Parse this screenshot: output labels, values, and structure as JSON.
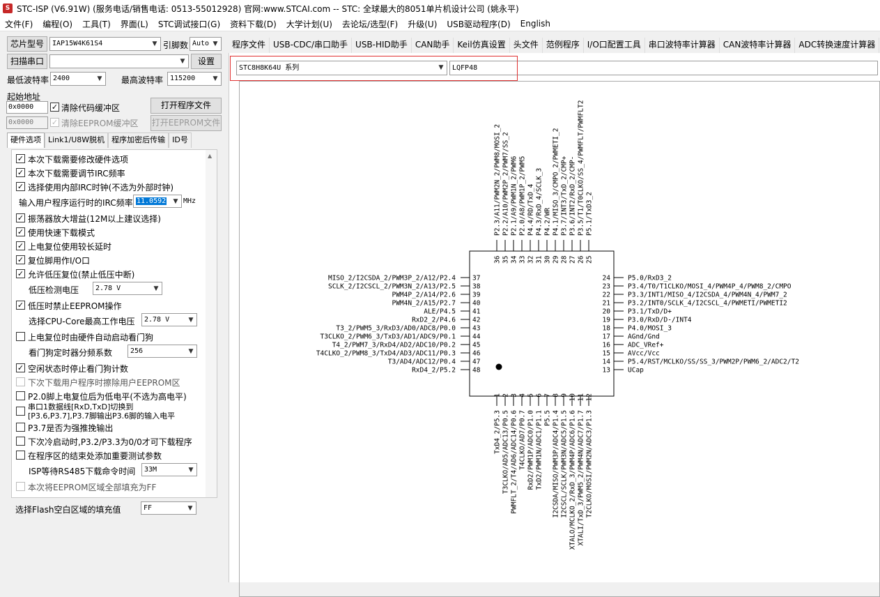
{
  "title": "STC-ISP (V6.91W) (服务电话/销售电话: 0513-55012928) 官网:www.STCAI.com  -- STC: 全球最大的8051单片机设计公司 (姚永平)",
  "menu": [
    "文件(F)",
    "编程(O)",
    "工具(T)",
    "界面(L)",
    "STC调试接口(G)",
    "资料下载(D)",
    "大学计划(U)",
    "去论坛/选型(F)",
    "升级(U)",
    "USB驱动程序(D)",
    "English"
  ],
  "left": {
    "chip_btn": "芯片型号",
    "chip_val": "IAP15W4K61S4",
    "pin_lbl": "引脚数",
    "pin_val": "Auto",
    "scan_btn": "扫描串口",
    "scan_val": "",
    "settings_btn": "设置",
    "minbaud_lbl": "最低波特率",
    "minbaud_val": "2400",
    "maxbaud_lbl": "最高波特率",
    "maxbaud_val": "115200",
    "start_lbl": "起始地址",
    "addr1": "0x0000",
    "clear_code": "清除代码缓冲区",
    "open_prog": "打开程序文件",
    "addr2": "0x0000",
    "clear_eeprom": "清除EEPROM缓冲区",
    "open_eeprom": "打开EEPROM文件",
    "tabs": [
      "硬件选项",
      "Link1/U8W脱机",
      "程序加密后传输",
      "ID号"
    ],
    "hw": {
      "o1": "本次下载需要修改硬件选项",
      "o2": "本次下载需要调节IRC频率",
      "o3": "选择使用内部IRC时钟(不选为外部时钟)",
      "irc_lbl": "输入用户程序运行时的IRC频率",
      "irc_val": "11.0592",
      "irc_unit": "MHz",
      "o4": "振荡器放大增益(12M以上建议选择)",
      "o5": "使用快速下载模式",
      "o6": "上电复位使用较长延时",
      "o7": "复位脚用作I/O口",
      "o8": "允许低压复位(禁止低压中断)",
      "lv_lbl": "低压检测电压",
      "lv_val": "2.78 V",
      "o9": "低压时禁止EEPROM操作",
      "cpu_lbl": "选择CPU-Core最高工作电压",
      "cpu_val": "2.78 V",
      "o10": "上电复位时由硬件自动启动看门狗",
      "wd_lbl": "看门狗定时器分频系数",
      "wd_val": "256",
      "o11": "空闲状态时停止看门狗计数",
      "o12": "下次下载用户程序时擦除用户EEPROM区",
      "o13": "P2.0脚上电复位后为低电平(不选为高电平)",
      "o14a": "串口1数据线[RxD,TxD]切换到",
      "o14b": "[P3.6,P3.7],P3.7脚输出P3.6脚的输入电平",
      "o15": "P3.7是否为强推挽输出",
      "o16": "下次冷启动时,P3.2/P3.3为0/0才可下载程序",
      "o17": "在程序区的结束处添加重要测试参数",
      "rs_lbl": "ISP等待RS485下载命令时间",
      "rs_val": "33M",
      "o18": "本次将EEPROM区域全部填充为FF"
    },
    "fill_lbl": "选择Flash空白区域的填充值",
    "fill_val": "FF"
  },
  "rtabs": [
    "程序文件",
    "USB-CDC/串口助手",
    "USB-HID助手",
    "CAN助手",
    "Keil仿真设置",
    "头文件",
    "范例程序",
    "I/O口配置工具",
    "串口波特率计算器",
    "CAN波特率计算器",
    "ADC转换速度计算器",
    "定时"
  ],
  "series_val": "STC8H8K64U 系列",
  "package_val": "LQFP48",
  "pins": {
    "left": [
      "MISO_2/I2CSDA_2/PWM3P_2/A12/P2.4",
      "SCLK_2/I2CSCL_2/PWM3N_2/A13/P2.5",
      "PWM4P_2/A14/P2.6",
      "PWM4N_2/A15/P2.7",
      "ALE/P4.5",
      "RxD2_2/P4.6",
      "T3_2/PWM5_3/RxD3/AD0/ADC8/P0.0",
      "T3CLKO_2/PWM6_3/TxD3/AD1/ADC9/P0.1",
      "T4_2/PWM7_3/RxD4/AD2/ADC10/P0.2",
      "T4CLKO_2/PWM8_3/TxD4/AD3/ADC11/P0.3",
      "T3/AD4/ADC12/P0.4",
      "RxD4_2/P5.2"
    ],
    "left_nums": [
      "37",
      "38",
      "39",
      "40",
      "41",
      "42",
      "43",
      "44",
      "45",
      "46",
      "47",
      "48"
    ],
    "right": [
      "P5.0/RxD3_2",
      "P3.4/T0/T1CLKO/MOSI_4/PWM4P_4/PWM8_2/CMPO",
      "P3.3/INT1/MISO_4/I2CSDA_4/PWM4N_4/PWM7_2",
      "P3.2/INT0/SCLK_4/I2CSCL_4/PWMETI/PWMETI2",
      "P3.1/TxD/D+",
      "P3.0/RxD/D-/INT4",
      "P4.0/MOSI_3",
      "AGnd/Gnd",
      "ADC_VRef+",
      "AVcc/Vcc",
      "P5.4/RST/MCLKO/SS/SS_3/PWM2P/PWM6_2/ADC2/T2",
      "UCap"
    ],
    "right_nums": [
      "24",
      "23",
      "22",
      "21",
      "20",
      "19",
      "18",
      "17",
      "16",
      "15",
      "14",
      "13"
    ],
    "top": [
      "P2.3/A11/PWM2N_2/PWM8/MOSI_2",
      "P2.2/A10/PWM2P_2/PWM7/SS_2",
      "P2.1/A9/PWM1N_2/PWM6",
      "P2.0/A8/PWM1P_2/PWM5",
      "P4.4/RD/TxD_4",
      "P4.3/RxD_4/SCLK_3",
      "P4.2/WR",
      "P4.1/MISO_3/CMPO_2/PWMETI_2",
      "P3.7/INT3/TxD_2/CMP+",
      "P3.6/INT2/RxD_2/CMP-",
      "P3.5/T1/T0CLKO/SS_4/PWMFLT/PWMFLT2",
      "P5.1/TxD3_2"
    ],
    "top_nums": [
      "36",
      "35",
      "34",
      "33",
      "32",
      "31",
      "30",
      "29",
      "28",
      "27",
      "26",
      "25"
    ],
    "bottom": [
      "TxD4_2/P5.3",
      "T3CLKO/AD5/ADC13/P0.5",
      "PWMFLT_2/T4/AD6/ADC14/P0.6",
      "T4CLKO/AD7/P0.7",
      "RxD2/PWM1P/ADC0/P1.0",
      "TxD2/PWM1N/ADC1/P1.1",
      "P5.5",
      "I2CSDA/MISO/PWM3P/ADC4/P1.4",
      "I2CSCL/SCLK/PWM3N/ADC5/P1.5",
      "XTALO/MCLKO_2/RxD_3/PWM4P/ADC6/P1.6",
      "XTALI/TxD_3/PWM5_2/PWM4N/ADC7/P1.7",
      "T2CLKO/MOSI/PWM2N/ADC3/P1.3"
    ],
    "bottom_nums": [
      "1",
      "2",
      "3",
      "4",
      "5",
      "6",
      "7",
      "8",
      "9",
      "10",
      "11",
      "12"
    ]
  }
}
